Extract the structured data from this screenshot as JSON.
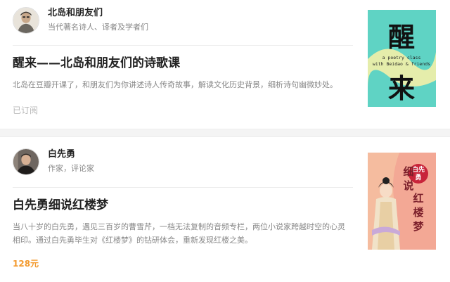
{
  "courses": [
    {
      "author_name": "北岛和朋友们",
      "author_desc": "当代著名诗人、译者及学者们",
      "title": "醒来——北岛和朋友们的诗歌课",
      "description": "北岛在豆瓣开课了，和朋友们为你讲述诗人传奇故事，解读文化历史背景，细析诗句幽微妙处。",
      "status": "已订阅",
      "cover": {
        "big_char_top": "醒",
        "big_char_bottom": "来",
        "subtitle_line1": "a poetry class",
        "subtitle_line2": "with Beidao & friends",
        "bg_color": "#5fd3c4",
        "accent_color": "#f4f0a8"
      }
    },
    {
      "author_name": "白先勇",
      "author_desc": "作家，评论家",
      "title": "白先勇细说红楼梦",
      "description": "当八十岁的白先勇，遇见三百岁的曹雪芹，一档无法复制的音频专栏，两位小说家跨越时空的心灵相印。通过白先勇毕生对《红楼梦》的钻研体会，重新发现红楼之美。",
      "price": "128元",
      "cover": {
        "seal_text_1": "白先",
        "seal_text_2": "勇",
        "title_chars": [
          "细",
          "说",
          "红",
          "楼",
          "梦"
        ],
        "bg_color": "#f3a895",
        "seal_color": "#c8243a"
      }
    }
  ]
}
